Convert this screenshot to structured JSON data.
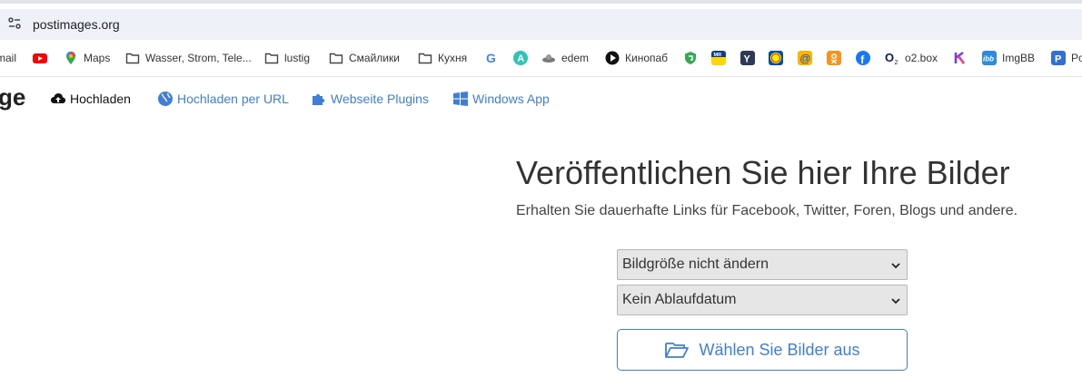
{
  "browser": {
    "url": "postimages.org",
    "bookmarks": [
      {
        "label": "mail",
        "icon": "gmail-icon"
      },
      {
        "label": "",
        "icon": "youtube-icon"
      },
      {
        "label": "Maps",
        "icon": "maps-pin-icon"
      },
      {
        "label": "Wasser, Strom, Tele...",
        "icon": "folder-icon"
      },
      {
        "label": "lustig",
        "icon": "folder-icon"
      },
      {
        "label": "Смайлики",
        "icon": "folder-icon"
      },
      {
        "label": "Кухня",
        "icon": "folder-icon"
      },
      {
        "label": "",
        "icon": "google-icon"
      },
      {
        "label": "",
        "icon": "a-circle-icon"
      },
      {
        "label": "edem",
        "icon": "edem-icon"
      },
      {
        "label": "Кинопаб",
        "icon": "kinopub-icon"
      },
      {
        "label": "",
        "icon": "shield-bookmark-icon"
      },
      {
        "label": "",
        "icon": "mr-icon"
      },
      {
        "label": "",
        "icon": "y-icon"
      },
      {
        "label": "",
        "icon": "lidl-icon"
      },
      {
        "label": "",
        "icon": "at-icon"
      },
      {
        "label": "",
        "icon": "ok-icon"
      },
      {
        "label": "",
        "icon": "facebook-icon"
      },
      {
        "label": "o2.box",
        "icon": "o2-icon"
      },
      {
        "label": "",
        "icon": "k-icon"
      },
      {
        "label": "ImgBB",
        "icon": "ibb-icon"
      },
      {
        "label": "Po",
        "icon": "p-icon"
      }
    ]
  },
  "site": {
    "logo_fragment": "ge",
    "nav": {
      "upload": "Hochladen",
      "upload_url": "Hochladen per URL",
      "plugins": "Webseite Plugins",
      "windows": "Windows App"
    },
    "headline": "Veröffentlichen Sie hier Ihre Bilder",
    "subline": "Erhalten Sie dauerhafte Links für Facebook, Twitter, Foren, Blogs und andere.",
    "size_select": "Bildgröße nicht ändern",
    "expiry_select": "Kein Ablaufdatum",
    "choose_button": "Wählen Sie Bilder aus"
  },
  "colors": {
    "accent": "#3f7fd8",
    "addressbar": "#eef1f7"
  }
}
